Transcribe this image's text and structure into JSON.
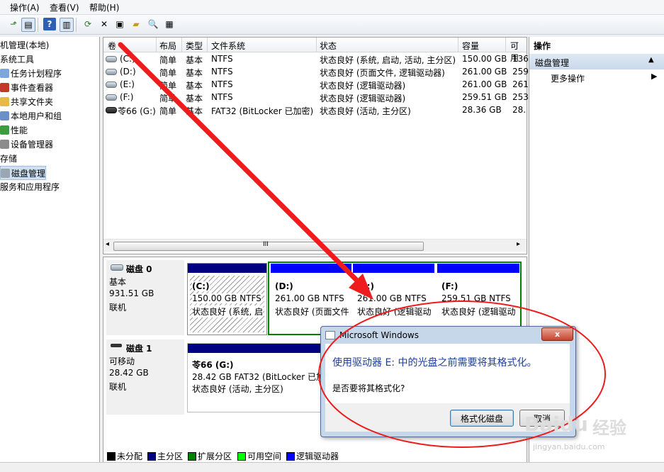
{
  "menubar": {
    "action": "操作(A)",
    "view": "查看(V)",
    "help": "帮助(H)"
  },
  "tree": {
    "items": [
      {
        "label": "机管理(本地)",
        "icon": "computer-icon",
        "indent": 0
      },
      {
        "label": "系统工具",
        "icon": "none",
        "indent": 0
      },
      {
        "label": "任务计划程序",
        "icon": "clock-icon",
        "indent": 1
      },
      {
        "label": "事件查看器",
        "icon": "event-viewer-icon",
        "indent": 1
      },
      {
        "label": "共享文件夹",
        "icon": "shared-folder-icon",
        "indent": 1
      },
      {
        "label": "本地用户和组",
        "icon": "users-icon",
        "indent": 1
      },
      {
        "label": "性能",
        "icon": "performance-icon",
        "indent": 1
      },
      {
        "label": "设备管理器",
        "icon": "device-manager-icon",
        "indent": 1
      },
      {
        "label": "存储",
        "icon": "none",
        "indent": 0
      },
      {
        "label": "磁盘管理",
        "icon": "disk-icon",
        "indent": 1,
        "selected": true
      },
      {
        "label": "服务和应用程序",
        "icon": "none",
        "indent": 0
      }
    ]
  },
  "volumes": {
    "headers": [
      "卷",
      "布局",
      "类型",
      "文件系统",
      "状态",
      "容量",
      "可用"
    ],
    "rows": [
      {
        "vol": "(C:)",
        "layout": "简单",
        "type": "基本",
        "fs": "NTFS",
        "status": "状态良好 (系统, 启动, 活动, 主分区)",
        "cap": "150.00 GB",
        "free": "136"
      },
      {
        "vol": "(D:)",
        "layout": "简单",
        "type": "基本",
        "fs": "NTFS",
        "status": "状态良好 (页面文件, 逻辑驱动器)",
        "cap": "261.00 GB",
        "free": "259"
      },
      {
        "vol": "(E:)",
        "layout": "简单",
        "type": "基本",
        "fs": "NTFS",
        "status": "状态良好 (逻辑驱动器)",
        "cap": "261.00 GB",
        "free": "261"
      },
      {
        "vol": "(F:)",
        "layout": "简单",
        "type": "基本",
        "fs": "NTFS",
        "status": "状态良好 (逻辑驱动器)",
        "cap": "259.51 GB",
        "free": "253"
      },
      {
        "vol": "苓66 (G:)",
        "layout": "简单",
        "type": "基本",
        "fs": "FAT32 (BitLocker 已加密)",
        "status": "状态良好 (活动, 主分区)",
        "cap": "28.36 GB",
        "free": "28."
      }
    ],
    "scroll_grip": "III"
  },
  "disks": [
    {
      "name": "磁盘 0",
      "kind": "基本",
      "size": "931.51 GB",
      "state": "联机",
      "partitions": [
        {
          "title": "(C:)",
          "line1": "150.00 GB NTFS",
          "line2": "状态良好 (系统, 启",
          "color": "#000080"
        },
        {
          "title": "(D:)",
          "line1": "261.00 GB NTFS",
          "line2": "状态良好 (页面文件",
          "color": "#0000ff"
        },
        {
          "title": "(E:)",
          "line1": "261.00 GB NTFS",
          "line2": "状态良好 (逻辑驱动",
          "color": "#0000ff"
        },
        {
          "title": "(F:)",
          "line1": "259.51 GB NTFS",
          "line2": "状态良好 (逻辑驱动",
          "color": "#0000ff"
        }
      ]
    },
    {
      "name": "磁盘 1",
      "kind": "可移动",
      "size": "28.42 GB",
      "state": "联机",
      "partitions": [
        {
          "title": "苓66  (G:)",
          "line1": "28.42 GB FAT32 (BitLocker 已加",
          "line2": "状态良好 (活动, 主分区)",
          "color": "#000080"
        }
      ]
    }
  ],
  "legend": [
    {
      "label": "未分配",
      "color": "#000000"
    },
    {
      "label": "主分区",
      "color": "#000080"
    },
    {
      "label": "扩展分区",
      "color": "#008000"
    },
    {
      "label": "可用空间",
      "color": "#00ff00"
    },
    {
      "label": "逻辑驱动器",
      "color": "#0000ff"
    }
  ],
  "actions": {
    "title": "操作",
    "section": "磁盘管理",
    "more": "更多操作"
  },
  "dialog": {
    "title": "Microsoft Windows",
    "close": "x",
    "heading": "使用驱动器 E: 中的光盘之前需要将其格式化。",
    "question": "是否要将其格式化?",
    "format_btn": "格式化磁盘",
    "cancel_btn": "取消"
  },
  "watermark": {
    "brand": "Baidu",
    "sub": "经验",
    "url": "jingyan.baidu.com"
  },
  "colors": {
    "annotation": "#ee1c1c",
    "dialog_heading": "#1e3f9a",
    "selection": "#cfe0f4"
  }
}
